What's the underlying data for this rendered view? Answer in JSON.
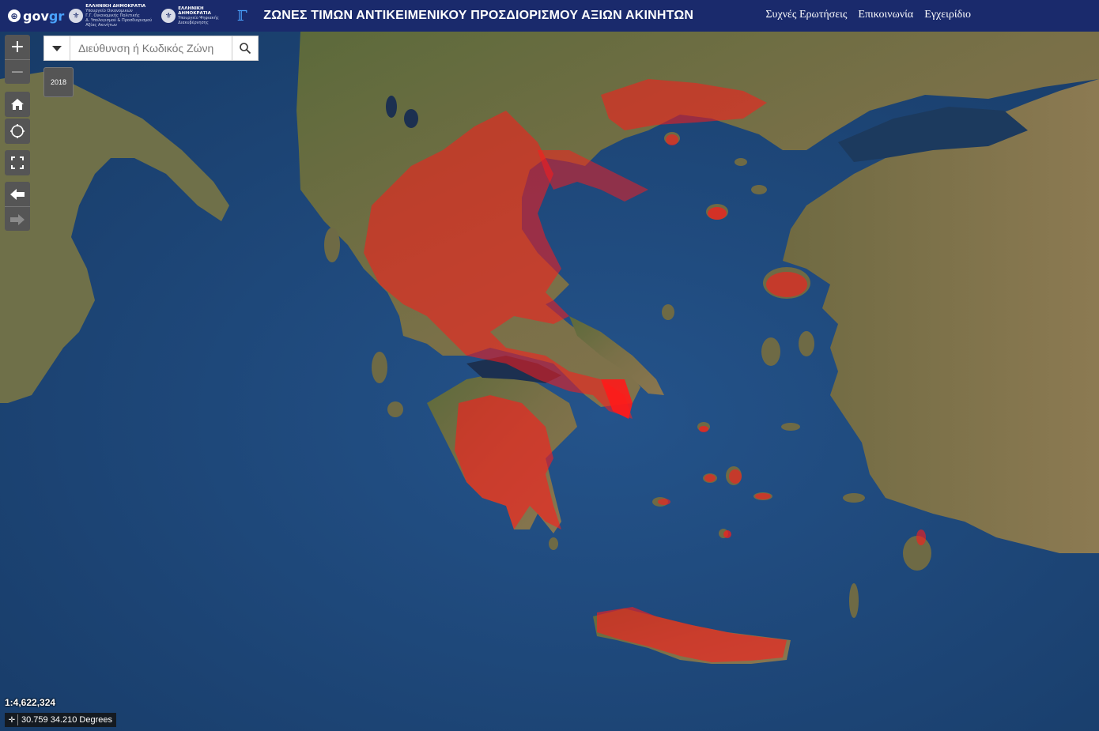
{
  "header": {
    "gov_brand": "gov",
    "gov_brand_accent": "gr",
    "ministry1_title": "ΕΛΛΗΝΙΚΗ ΔΗΜΟΚΡΑΤΙΑ",
    "ministry1_line1": "Υπουργείο Οικονομικών",
    "ministry1_line2": "Γ.Γ. Οικονομικής Πολιτικής",
    "ministry1_line3": "Δ. Υπολογισμού & Προσδιορισμού Αξίας Ακινήτων",
    "ministry2_title": "ΕΛΛΗΝΙΚΗ ΔΗΜΟΚΡΑΤΙΑ",
    "ministry2_line1": "Υπουργείο Ψηφιακής",
    "ministry2_line2": "Διακυβέρνησης",
    "title": "ΖΩΝΕΣ ΤΙΜΩΝ ΑΝΤΙΚΕΙΜΕΝΙΚΟΥ ΠΡΟΣΔΙΟΡΙΣΜΟΥ ΑΞΙΩΝ ΑΚΙΝΗΤΩΝ",
    "nav": [
      "Συχνές Ερωτήσεις",
      "Επικοινωνία",
      "Εγχειρίδιο"
    ]
  },
  "search": {
    "placeholder": "Διεύθυνση ή Κωδικός Ζώνη",
    "value": ""
  },
  "year_chip": "2018",
  "controls": {
    "zoom_in": "+",
    "zoom_out": "−"
  },
  "scale_label": "1:4,622,324",
  "coordinates": "30.759 34.210 Degrees",
  "colors": {
    "header_bg": "#1a2a6c",
    "sea": "#1f4a7d",
    "land": "#6b6a45",
    "zone_marker": "#ff1a1a"
  },
  "icons": [
    "home-icon",
    "locate-icon",
    "fullscreen-icon",
    "back-arrow-icon",
    "forward-arrow-icon",
    "search-icon",
    "chevron-down-icon",
    "crosshair-icon"
  ]
}
